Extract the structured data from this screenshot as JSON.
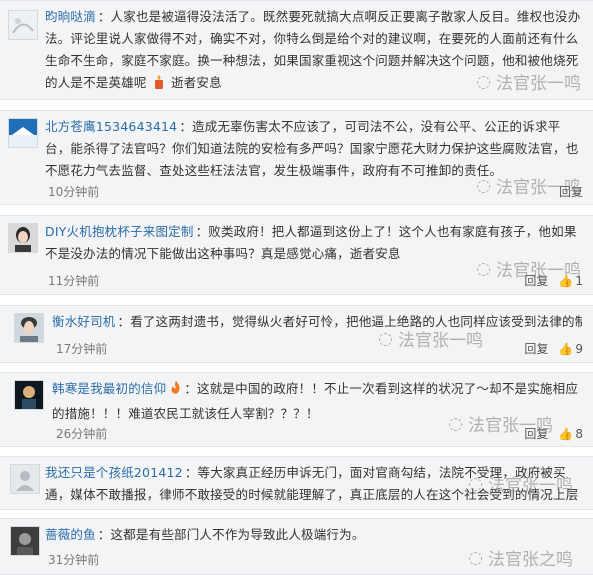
{
  "comments": [
    {
      "user": "昀晌哒滴",
      "text": "：人家也是被逼得没法活了。既然要死就搞大点啊反正要离子散家人反目。维权也没办法。评论里说人家做得不对，确实不对，你特么倒是给个对的建议啊，在要死的人面前还有什么生命不生命，家庭不家庭。换一种想法，如果国家重视这个问题并解决这个问题，他和被他烧死的人是不是英雄呢",
      "suffix": "逝者安息"
    },
    {
      "user": "北方苍鹰1534643414",
      "text": "：造成无辜伤害太不应该了，可司法不公，没有公平、公正的诉求平台，能杀得了法官吗？你们知道法院的安检有多严吗？国家宁愿花大财力保护这些腐败法官，也不愿花力气去监督、查处这些枉法法官，发生极端事件，政府有不可推卸的责任。",
      "time": "10分钟前",
      "reply": "回复"
    },
    {
      "user": "DIY火机抱枕杯子来图定制",
      "text": "：败类政府！把人都逼到这份上了！这个人也有家庭有孩子，他如果不是没办法的情况下能做出这种事吗？真是感觉心痛，逝者安息",
      "time": "11分钟前",
      "reply": "回复",
      "likes": "1"
    },
    {
      "user": "衡水好司机",
      "text": "：看了这两封遗书，觉得纵火者好可怜，把他逼上绝路的人也同样应该受到法律的制裁。",
      "time": "17分钟前",
      "reply": "回复",
      "likes": "9"
    },
    {
      "user": "韩寒是我最初的信仰",
      "text": "：这就是中国的政府！！不止一次看到这样的状况了～却不是实施相应的措施！！！难道农民工就该任人宰割？？？！",
      "time": "26分钟前",
      "reply": "回复",
      "likes": "8"
    },
    {
      "user": "我还只是个孩纸201412",
      "text": "：等大家真正经历申诉无门，面对官商勾结，法院不受理，政府被买通，媒体不敢播报，律师不敢接受的时候就能理解了，真正底层的人在这个社会受到的情况上层谁理过了？"
    },
    {
      "user": "蔷薇的鱼",
      "text": "：这都是有些部门人不作为导致此人极端行为。",
      "time": "31分钟前"
    }
  ],
  "watermark": "法官张一鸣",
  "watermark_last": "法官张之鸣",
  "colors": {
    "username": "#2c6ca8",
    "card_bg": "#f3f4f6"
  }
}
